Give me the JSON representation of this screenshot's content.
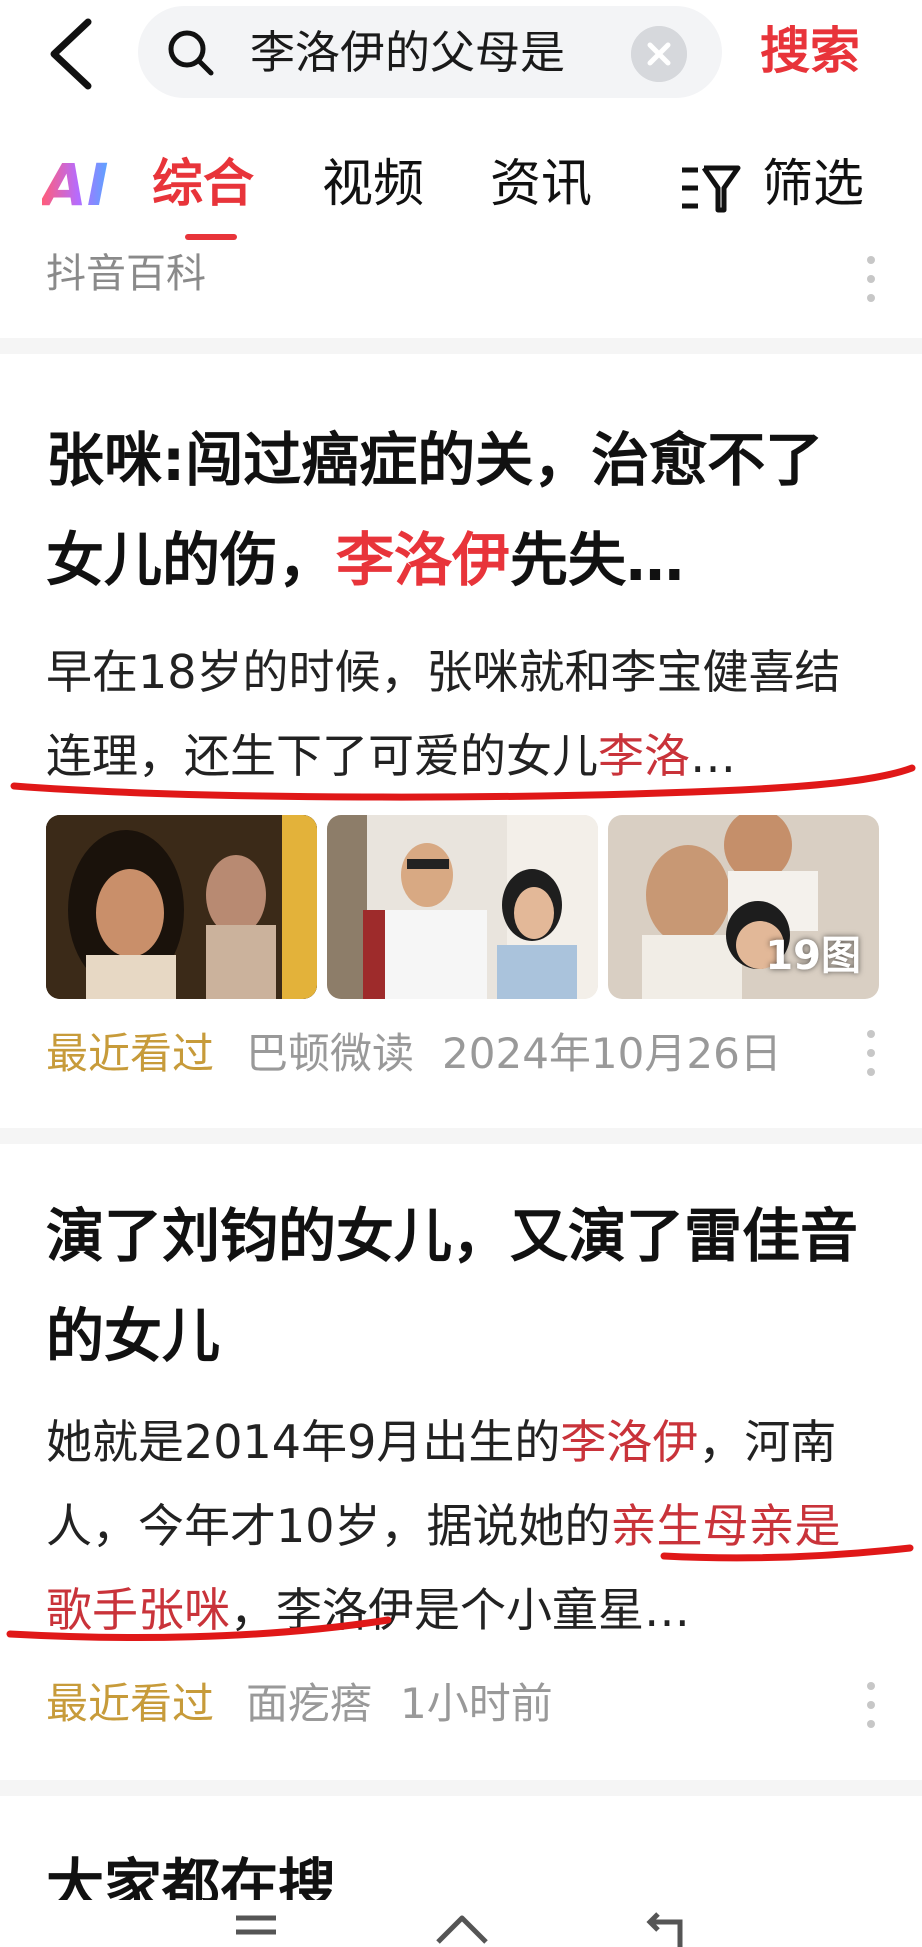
{
  "search": {
    "query": "李洛伊的父母是",
    "submit_label": "搜索"
  },
  "tabs": [
    {
      "label": "AI"
    },
    {
      "label": "综合"
    },
    {
      "label": "视频"
    },
    {
      "label": "资讯"
    },
    {
      "label": "筛选"
    }
  ],
  "top_source": "抖音百科",
  "results": [
    {
      "title_a": "张咪:闯过癌症的关，治愈不了女儿的伤，",
      "title_hl": "李洛伊",
      "title_b": "先失…",
      "desc_a": "早在18岁的时候，张咪就和李宝健喜结连理，还生下了可爱的女儿",
      "desc_hl": "李洛",
      "desc_b": "…",
      "image_count": "19图",
      "recent": "最近看过",
      "source": "巴顿微读",
      "date": "2024年10月26日"
    },
    {
      "title": "演了刘钧的女儿，又演了雷佳音的女儿",
      "desc_a": "她就是2014年9月出生的",
      "desc_hl1": "李洛伊",
      "desc_b": "，河南人，今年才10岁，据说她的",
      "desc_hl2": "亲生母亲是歌手张咪",
      "desc_c": "，李洛伊是个小童星…",
      "recent": "最近看过",
      "source": "面疙瘩",
      "date": "1小时前"
    }
  ],
  "partial_heading": "大家都在搜",
  "colors": {
    "accent": "#e8343a",
    "recent": "#c79b3a",
    "meta": "#999999"
  },
  "icons": [
    "back-arrow-icon",
    "search-icon",
    "clear-icon",
    "filter-icon",
    "more-icon",
    "menu-icon",
    "home-icon",
    "back-nav-icon"
  ]
}
